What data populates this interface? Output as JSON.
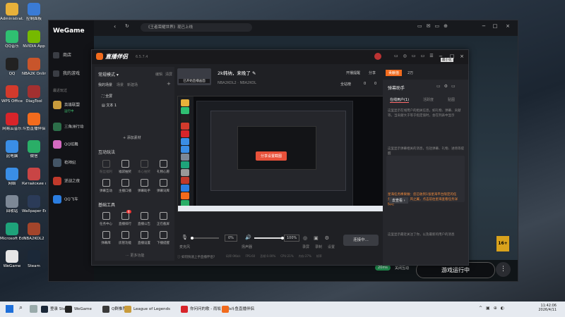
{
  "desktop_icons": [
    {
      "label": "Administrat...",
      "color": "#e8b13a"
    },
    {
      "label": "QQ音乐",
      "color": "#2fbf71"
    },
    {
      "label": "QQ",
      "color": "#222222"
    },
    {
      "label": "WPS Office",
      "color": "#d33a2c"
    },
    {
      "label": "网易云音乐",
      "color": "#d8242a"
    },
    {
      "label": "此电脑",
      "color": "#3a8ee6"
    },
    {
      "label": "网络",
      "color": "#3a8ee6"
    },
    {
      "label": "回收站",
      "color": "#7d8896"
    },
    {
      "label": "Microsoft Edge",
      "color": "#1ea37a"
    },
    {
      "label": "WeGame",
      "color": "#e6e6e6"
    },
    {
      "label": "控制面板",
      "color": "#3a7bd5"
    },
    {
      "label": "NVIDIA App",
      "color": "#76b900"
    },
    {
      "label": "NBA2K Online",
      "color": "#c8552b"
    },
    {
      "label": "DiagTool",
      "color": "#a33030"
    },
    {
      "label": "斗鱼直播伴侣",
      "color": "#f26b1d"
    },
    {
      "label": "微信",
      "color": "#2aae67"
    },
    {
      "label": "Китайские фестиваль",
      "color": "#c94545"
    },
    {
      "label": "Wallpaper Engine",
      "color": "#2b3b58"
    },
    {
      "label": "NBA2KOL2",
      "color": "#a3452b"
    },
    {
      "label": "Steam",
      "color": "#1b2838"
    }
  ],
  "wegame": {
    "logo": "WeGame",
    "search": "《王者荣耀世界》现已上线",
    "nav": [
      {
        "label": "商店"
      },
      {
        "label": "我的游戏"
      }
    ],
    "recent_label": "最近玩过",
    "games": [
      {
        "label": "英雄联盟",
        "sub": "运行中",
        "color": "#c89b3c"
      },
      {
        "label": "三角洲行动",
        "color": "#2c6e49"
      },
      {
        "label": "QQ炫舞",
        "color": "#d46ac1"
      },
      {
        "label": "枪神纪",
        "color": "#445566"
      },
      {
        "label": "逆战之夜",
        "color": "#c0392b"
      },
      {
        "label": "QQ飞车",
        "color": "#2b7de0"
      }
    ],
    "play_button": "游戏运行中",
    "more_button": "⋮",
    "bottom_tags": [
      "20ms",
      "关闭互动"
    ],
    "age_badge": "16+"
  },
  "streamer": {
    "title": "直播伴侣",
    "version": "6.5.7.4",
    "coins": "2万",
    "tip": "最小化",
    "mode_label": "常规模式",
    "edit": "编辑",
    "clear": "清屏",
    "scene_title": "我的场景",
    "scene_tabs": [
      "场景",
      "新建场"
    ],
    "sources": [
      "全屏",
      "文本 1"
    ],
    "add_source": "+ 添加素材",
    "stream_title": "2k韩纳，来晚了",
    "category": "已开始直播画面",
    "breadcrumb": "NBA2KOL2 · NBA2KOL",
    "right_actions": [
      "开播提醒",
      "分享"
    ],
    "stats": [
      "全站榜",
      "0",
      "0"
    ],
    "interact_title": "互动玩法",
    "interact_tools": [
      {
        "label": "粉丝福利",
        "dim": true
      },
      {
        "label": "福袋抽奖",
        "dim": false
      },
      {
        "label": "本心抽奖",
        "dim": true
      },
      {
        "label": "礼物心愿",
        "dim": false
      },
      {
        "label": "弹幕互动",
        "dim": false
      },
      {
        "label": "主播口播",
        "dim": false
      },
      {
        "label": "弹幕助手",
        "dim": false
      },
      {
        "label": "弹幕词库",
        "dim": false
      }
    ],
    "basic_title": "基础工具",
    "basic_tools": [
      {
        "label": "任务中心",
        "badge": ""
      },
      {
        "label": "直播排行",
        "badge": "8"
      },
      {
        "label": "直播公告",
        "badge": ""
      },
      {
        "label": "正在截屏",
        "badge": ""
      },
      {
        "label": "弹幕库",
        "badge": ""
      },
      {
        "label": "房管功能",
        "badge": ""
      },
      {
        "label": "直播设置",
        "badge": ""
      },
      {
        "label": "下播提醒",
        "badge": ""
      }
    ],
    "more_tools": "更多功能",
    "preview_popup": "分享设置截图",
    "mic_label": "麦克风",
    "mic_value": "0%",
    "speaker_label": "扬声器",
    "speaker_value": "100%",
    "controls": [
      "录屏",
      "录制",
      "设置"
    ],
    "live_button": "连接中...",
    "status_bar": [
      "码率:0Kb/s",
      "FPS:60",
      "丢帧:0.00%",
      "CPU:21%",
      "内存:27%",
      "帧率"
    ],
    "bottom_hint": "如何快速上手直播伴侣?",
    "right_tabs": [
      "贡献值",
      "2万"
    ],
    "assistant_title": "弹幕助手",
    "assistant_tabs": [
      "在线用户(1)",
      "活跃度",
      "贴图"
    ],
    "assistant_empty_1": "这里显示在线用户的相关信息，如礼物、弹幕、贡献等，当贡献大于等于指定值时，会在列表中显示",
    "assistant_empty_2": "这里显示弹幕相关的消息，包括弹幕、礼物、进场等提醒",
    "assistant_highlight": "星海任务棒果做：您已收到1张星海平台限定的任务，产品名称：风之翼，点击前往星海查看任务详情吧",
    "assistant_link": "去查看 ›",
    "assistant_footer": "这里显示最近关注了你，以及最新的用户的消息"
  },
  "taskbar": {
    "items": [
      {
        "label": "登录 Steam",
        "color": "#1b2838"
      },
      {
        "label": "WeGame",
        "color": "#222"
      },
      {
        "label": "Q群推荐",
        "color": "#3a3a3a"
      },
      {
        "label": "League of Legends",
        "color": "#c89b3c"
      },
      {
        "label": "你问问的歌 - 雨坂 / Jels",
        "color": "#d8242a"
      },
      {
        "label": "斗鱼直播伴侣",
        "color": "#f26b1d"
      }
    ],
    "time": "11:42:06",
    "date": "2026/4/11"
  }
}
